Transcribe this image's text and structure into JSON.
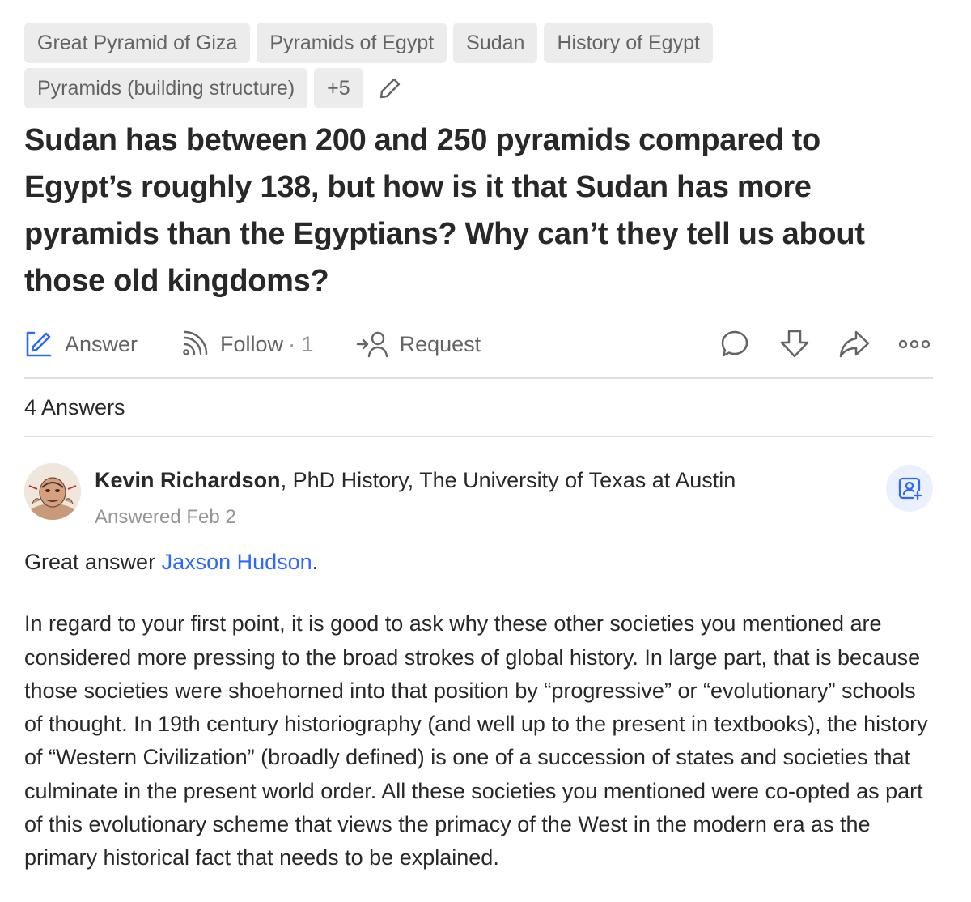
{
  "topics": [
    "Great Pyramid of Giza",
    "Pyramids of Egypt",
    "Sudan",
    "History of Egypt",
    "Pyramids (building structure)",
    "+5"
  ],
  "question": {
    "title": "Sudan has between 200 and 250 pyramids compared to Egypt’s roughly 138, but how is it that Sudan has more pyramids than the Egyptians? Why can’t they tell us about those old kingdoms?"
  },
  "actions": {
    "answer_label": "Answer",
    "follow_label": "Follow",
    "follow_count": "· 1",
    "request_label": "Request"
  },
  "icons": {
    "answer": "pencil-square-icon",
    "follow": "rss-follow-icon",
    "request": "request-person-icon",
    "comment": "comment-bubble-icon",
    "downvote": "downvote-arrow-icon",
    "share": "share-arrow-icon",
    "more": "more-dots-icon",
    "edit_topics": "pencil-icon",
    "save": "bookmark-person-icon"
  },
  "colors": {
    "accent": "#2e69ff",
    "text": "#282829",
    "muted": "#636466",
    "chip_bg": "#ececec"
  },
  "answers": {
    "count_label": "4 Answers",
    "items": [
      {
        "author_name": "Kevin Richardson",
        "author_credential": ", PhD History, The University of Texas at Austin",
        "date": "Answered Feb 2",
        "greeting_prefix": "Great answer ",
        "mention": "Jaxson Hudson",
        "greeting_suffix": ".",
        "paragraph": "In regard to your first point, it is good to ask why these other societies you mentioned are considered more pressing to the broad strokes of global history. In large part, that is because those societies were shoehorned into that position by “progressive” or “evolutionary” schools of thought. In 19th century historiography (and well up to the present in textbooks), the history of “Western Civilization” (broadly defined) is one of a succession of states and societies that culminate in the present world order. All these societies you mentioned were co-opted as part of this evolutionary scheme that views the primacy of the West in the modern era as the primary historical fact that needs to be explained."
      }
    ]
  }
}
